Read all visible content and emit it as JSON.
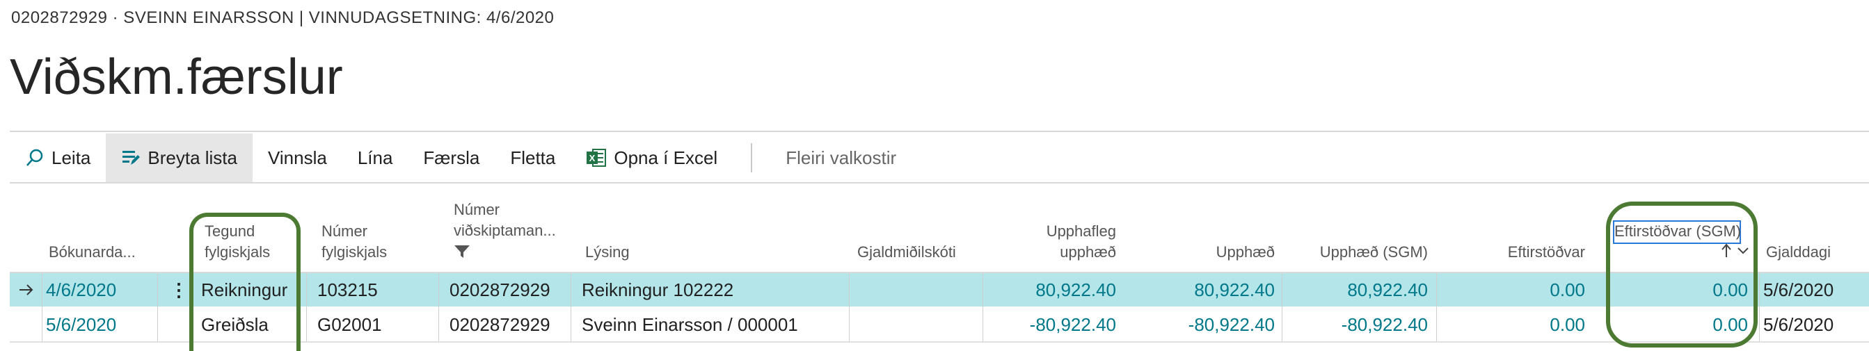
{
  "breadcrumb": "0202872929 · SVEINN EINARSSON | VINNUDAGSETNING: 4/6/2020",
  "page_title": "Viðskm.færslur",
  "toolbar": {
    "search": "Leita",
    "edit_list": "Breyta lista",
    "process": "Vinnsla",
    "line": "Lína",
    "entry": "Færsla",
    "navigate": "Fletta",
    "open_excel": "Opna í Excel",
    "more_options": "Fleiri valkostir"
  },
  "columns": {
    "posting_date": "Bókunarda...",
    "doc_type_1": "Tegund",
    "doc_type_2": "fylgiskjals",
    "doc_no_1": "Númer",
    "doc_no_2": "fylgiskjals",
    "cust_no_1": "Númer",
    "cust_no_2": "viðskiptaman...",
    "description": "Lýsing",
    "currency": "Gjaldmiðilskóti",
    "orig_amount_1": "Upphafleg",
    "orig_amount_2": "upphæð",
    "amount": "Upphæð",
    "amount_lcy": "Upphæð (SGM)",
    "remaining": "Eftirstöðvar",
    "remaining_lcy": "Eftirstöðvar (SGM)",
    "due_date": "Gjalddagi"
  },
  "rows": [
    {
      "posting_date": "4/6/2020",
      "doc_type": "Reikningur",
      "doc_no": "103215",
      "cust_no": "0202872929",
      "description": "Reikningur 102222",
      "currency": "",
      "orig_amount": "80,922.40",
      "amount": "80,922.40",
      "amount_lcy": "80,922.40",
      "remaining": "0.00",
      "remaining_lcy": "0.00",
      "due_date": "5/6/2020"
    },
    {
      "posting_date": "5/6/2020",
      "doc_type": "Greiðsla",
      "doc_no": "G02001",
      "cust_no": "0202872929",
      "description": "Sveinn Einarsson / 000001",
      "currency": "",
      "orig_amount": "-80,922.40",
      "amount": "-80,922.40",
      "amount_lcy": "-80,922.40",
      "remaining": "0.00",
      "remaining_lcy": "0.00",
      "due_date": "5/6/2020"
    }
  ],
  "icons": {
    "search": "search-icon",
    "edit_list": "edit-list-icon",
    "excel": "excel-icon",
    "filter": "filter-icon",
    "sort": "sort-ascending-icon",
    "chevron": "chevron-down-icon",
    "row_arrow": "row-selected-arrow-icon",
    "row_menu": "row-actions-ellipsis-icon"
  },
  "colors": {
    "accent": "#00788a",
    "selected_row": "#b3e5e9",
    "callout": "#4d7a32",
    "excel": "#217346",
    "focus": "#2b79d6"
  }
}
